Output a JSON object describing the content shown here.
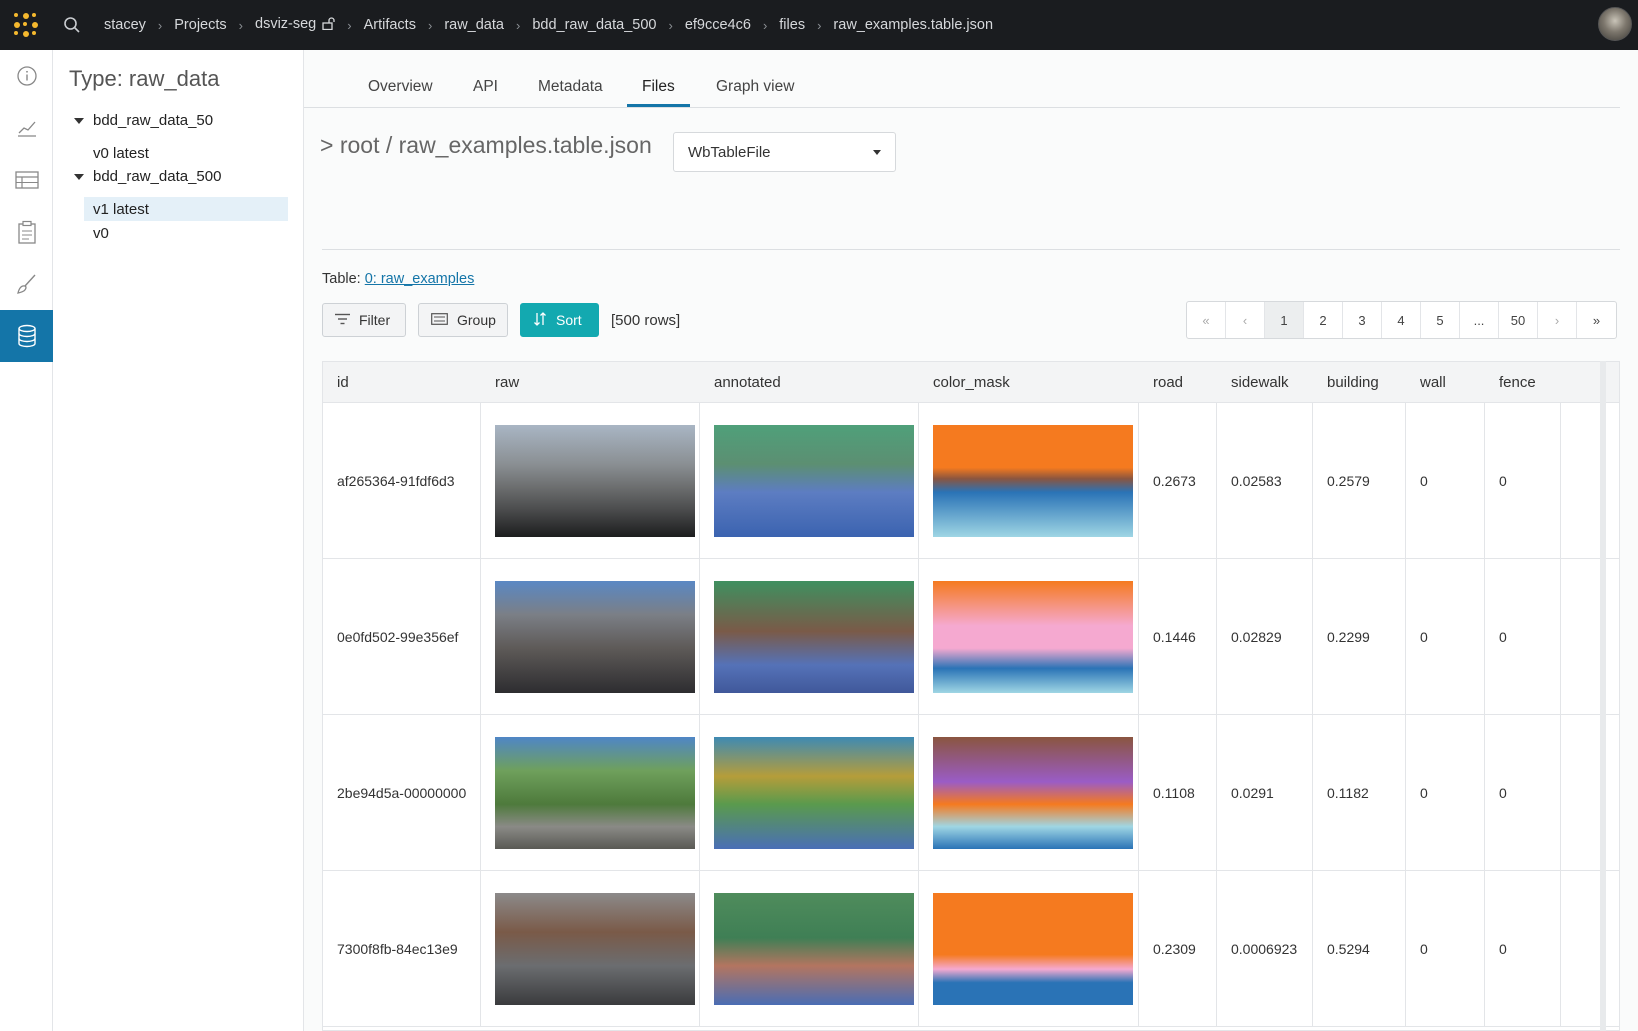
{
  "breadcrumbs": [
    "stacey",
    "Projects",
    "dsviz-seg",
    "Artifacts",
    "raw_data",
    "bdd_raw_data_500",
    "ef9cce4c6",
    "files",
    "raw_examples.table.json"
  ],
  "rail": [
    "info-icon",
    "chart-line-icon",
    "table-icon",
    "clipboard-icon",
    "brush-icon",
    "database-icon"
  ],
  "tree": {
    "title": "Type: raw_data",
    "groups": [
      {
        "name": "bdd_raw_data_50",
        "versions": [
          "v0 latest"
        ]
      },
      {
        "name": "bdd_raw_data_500",
        "versions": [
          "v1 latest",
          "v0"
        ]
      }
    ],
    "selected": "v1 latest"
  },
  "tabs": [
    "Overview",
    "API",
    "Metadata",
    "Files",
    "Graph view"
  ],
  "active_tab": "Files",
  "path": "> root / raw_examples.table.json",
  "dropdown": {
    "value": "WbTableFile"
  },
  "table_label": {
    "prefix": "Table: ",
    "link": "0: raw_examples"
  },
  "toolbar": {
    "filter": "Filter",
    "group": "Group",
    "sort": "Sort",
    "rows": "[500 rows]"
  },
  "pager": [
    "«",
    "‹",
    "1",
    "2",
    "3",
    "4",
    "5",
    "...",
    "50",
    "›",
    "»"
  ],
  "pager_active": "1",
  "columns": [
    "id",
    "raw",
    "annotated",
    "color_mask",
    "road",
    "sidewalk",
    "building",
    "wall",
    "fence"
  ],
  "rows": [
    {
      "id": "af265364-91fdf6d3",
      "road": "0.2673",
      "sidewalk": "0.02583",
      "building": "0.2579",
      "wall": "0",
      "fence": "0"
    },
    {
      "id": "0e0fd502-99e356ef",
      "road": "0.1446",
      "sidewalk": "0.02829",
      "building": "0.2299",
      "wall": "0",
      "fence": "0"
    },
    {
      "id": "2be94d5a-00000000",
      "road": "0.1108",
      "sidewalk": "0.0291",
      "building": "0.1182",
      "wall": "0",
      "fence": "0"
    },
    {
      "id": "7300f8fb-84ec13e9",
      "road": "0.2309",
      "sidewalk": "0.0006923",
      "building": "0.5294",
      "wall": "0",
      "fence": "0"
    }
  ],
  "colors": {
    "accent": "#1475a8",
    "sort_button": "#13a9b0",
    "topbar": "#1a1c1f",
    "logo": "#f5b82e"
  }
}
